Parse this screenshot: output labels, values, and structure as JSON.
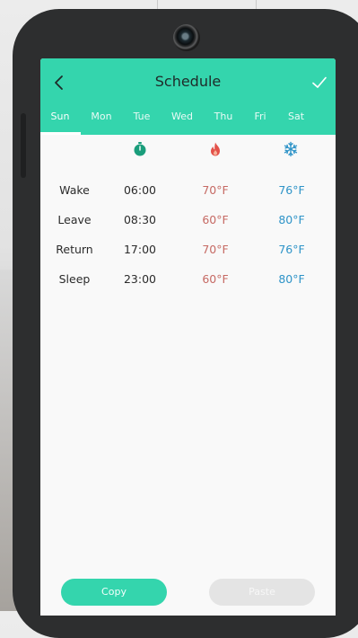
{
  "header": {
    "title": "Schedule",
    "back_icon": "chevron-left-icon",
    "confirm_icon": "check-icon"
  },
  "tabs": [
    {
      "label": "Sun",
      "active": true
    },
    {
      "label": "Mon",
      "active": false
    },
    {
      "label": "Tue",
      "active": false
    },
    {
      "label": "Wed",
      "active": false
    },
    {
      "label": "Thu",
      "active": false
    },
    {
      "label": "Fri",
      "active": false
    },
    {
      "label": "Sat",
      "active": false
    }
  ],
  "columns": {
    "time_icon": "timer-icon",
    "heat_icon": "flame-icon",
    "cool_icon": "snowflake-icon"
  },
  "rows": [
    {
      "name": "Wake",
      "time": "06:00",
      "heat": "70°F",
      "cool": "76°F"
    },
    {
      "name": "Leave",
      "time": "08:30",
      "heat": "60°F",
      "cool": "80°F"
    },
    {
      "name": "Return",
      "time": "17:00",
      "heat": "70°F",
      "cool": "76°F"
    },
    {
      "name": "Sleep",
      "time": "23:00",
      "heat": "60°F",
      "cool": "80°F"
    }
  ],
  "actions": {
    "copy_label": "Copy",
    "paste_label": "Paste",
    "paste_enabled": false
  },
  "colors": {
    "accent": "#34d5ad",
    "heat": "#c66a64",
    "cool": "#2f94c8",
    "timer": "#1a9d7b"
  }
}
